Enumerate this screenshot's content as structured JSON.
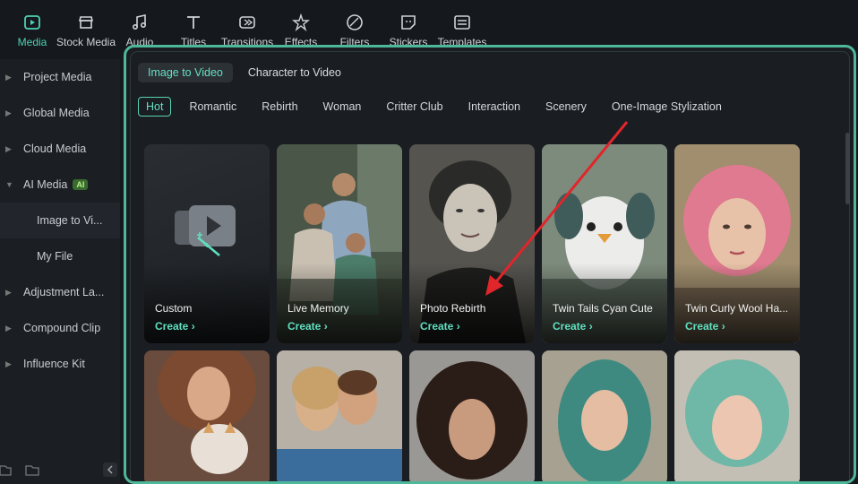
{
  "toolbar": {
    "items": [
      {
        "label": "Media",
        "icon": "media-icon",
        "active": true
      },
      {
        "label": "Stock Media",
        "icon": "stock-media-icon",
        "active": false
      },
      {
        "label": "Audio",
        "icon": "audio-icon",
        "active": false
      },
      {
        "label": "Titles",
        "icon": "titles-icon",
        "active": false
      },
      {
        "label": "Transitions",
        "icon": "transitions-icon",
        "active": false
      },
      {
        "label": "Effects",
        "icon": "effects-icon",
        "active": false
      },
      {
        "label": "Filters",
        "icon": "filters-icon",
        "active": false
      },
      {
        "label": "Stickers",
        "icon": "stickers-icon",
        "active": false
      },
      {
        "label": "Templates",
        "icon": "templates-icon",
        "active": false
      }
    ]
  },
  "sidebar": {
    "items": [
      {
        "label": "Project Media"
      },
      {
        "label": "Global Media"
      },
      {
        "label": "Cloud Media"
      },
      {
        "label": "AI Media",
        "badge": "AI"
      },
      {
        "label": "Image to Vi..."
      },
      {
        "label": "My File"
      },
      {
        "label": "Adjustment La..."
      },
      {
        "label": "Compound Clip"
      },
      {
        "label": "Influence Kit"
      }
    ]
  },
  "panel": {
    "tabs": [
      {
        "label": "Image to Video",
        "active": true
      },
      {
        "label": "Character to Video",
        "active": false
      }
    ],
    "categories": [
      "Hot",
      "Romantic",
      "Rebirth",
      "Woman",
      "Critter Club",
      "Interaction",
      "Scenery",
      "One-Image Stylization"
    ],
    "active_category": "Hot",
    "cards": [
      {
        "title": "Custom",
        "action": "Create"
      },
      {
        "title": "Live Memory",
        "action": "Create"
      },
      {
        "title": "Photo Rebirth",
        "action": "Create"
      },
      {
        "title": "Twin Tails Cyan Cute",
        "action": "Create"
      },
      {
        "title": "Twin Curly Wool Ha...",
        "action": "Create"
      }
    ]
  },
  "colors": {
    "accent": "#4fd1b4",
    "panel_border": "#4fb89a",
    "annotation_arrow": "#e0262b"
  }
}
